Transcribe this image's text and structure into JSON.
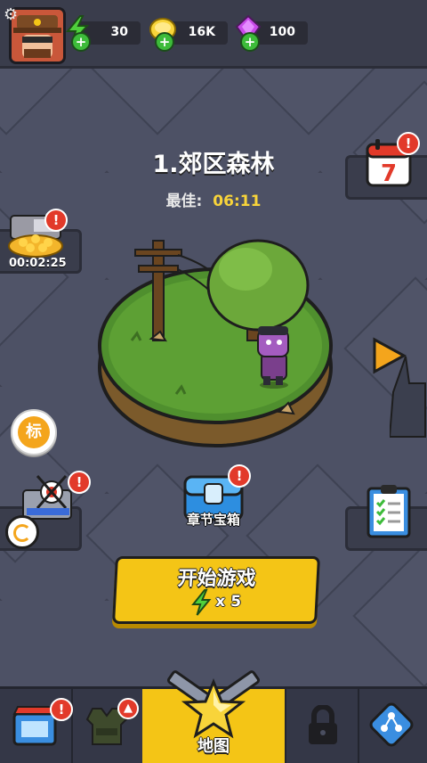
{
  "resources": {
    "energy": "30",
    "gold": "16K",
    "gems": "100"
  },
  "level": {
    "title": "1.郊区森林",
    "best_label": "最佳:",
    "best_time": "06:11"
  },
  "left_buttons": {
    "treasure_timer": "00:02:25",
    "tag_label": "标"
  },
  "right_buttons": {
    "calendar_day": "7"
  },
  "chest": {
    "label": "章节宝箱"
  },
  "start": {
    "label": "开始游戏",
    "cost": "x 5"
  },
  "nav": {
    "map_label": "地图"
  },
  "badges": {
    "mark": "!"
  },
  "colors": {
    "accent_yellow": "#f4c516",
    "badge_red": "#e23a2a",
    "gold_text": "#f8d43a",
    "energy_green": "#3dbb3a",
    "gem_purple": "#b13ad8"
  }
}
